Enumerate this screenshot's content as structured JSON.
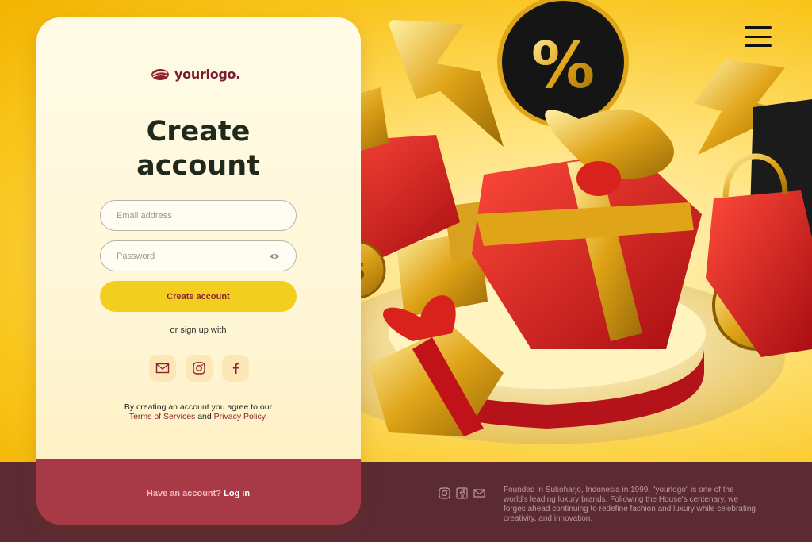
{
  "brand": {
    "logo_text": "yourlogo."
  },
  "form": {
    "title_line1": "Create",
    "title_line2": "account",
    "email_placeholder": "Email address",
    "password_placeholder": "Password",
    "submit_label": "Create account",
    "alt_signup": "or sign up with",
    "social": [
      {
        "icon": "mail-icon"
      },
      {
        "icon": "instagram-icon"
      },
      {
        "icon": "facebook-icon"
      }
    ],
    "terms_text": "By creating an account you agree to our",
    "terms_link": "Terms of Services",
    "terms_and": "and",
    "privacy_link": "Privacy Policy",
    "terms_end": "."
  },
  "login": {
    "prompt": "Have an account?",
    "link": "Log in"
  },
  "footer": {
    "about": "Founded in Sukoharjo, Indonesia in 1999, \"yourlogo\" is one of the world's leading luxury brands. Following the House's centenary, we forges ahead continuing to redefine fashion and luxury while celebrating creativity, and innovation."
  },
  "colors": {
    "primary_yellow": "#f2cf1e",
    "brand_red": "#8a2433",
    "footer_bg": "#5c2a33",
    "card_bottom": "#a83a47"
  }
}
